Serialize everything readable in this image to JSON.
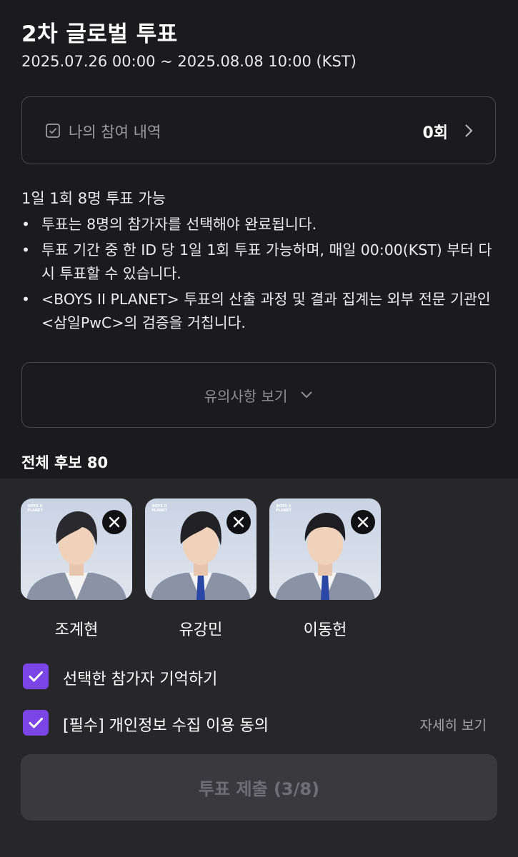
{
  "header": {
    "title": "2차 글로벌 투표",
    "period": "2025.07.26 00:00 ~ 2025.08.08 10:00 (KST)"
  },
  "history": {
    "label": "나의 참여 내역",
    "count": "0회"
  },
  "rules": {
    "headline": "1일 1회 8명 투표 가능",
    "items": [
      "투표는 8명의 참가자를 선택해야 완료됩니다.",
      "투표 기간 중 한 ID 당 1일 1회 투표 가능하며, 매일 00:00(KST) 부터 다시 투표할 수 있습니다.",
      "<BOYS II PLANET> 투표의 산출 과정 및 결과 집계는 외부 전문 기관인 <삼일PwC>의 검증을 거칩니다."
    ]
  },
  "notice": {
    "label": "유의사항 보기"
  },
  "candidates_total": "전체 후보 80",
  "selected": [
    {
      "name": "조계현",
      "logo": "BOYS II PLANET"
    },
    {
      "name": "유강민",
      "logo": "BOYS II PLANET"
    },
    {
      "name": "이동헌",
      "logo": "BOYS II PLANET"
    }
  ],
  "options": {
    "remember": {
      "label": "선택한 참가자 기억하기",
      "checked": true
    },
    "consent": {
      "label": "[필수] 개인정보 수집 이용 동의",
      "checked": true,
      "detail": "자세히 보기"
    }
  },
  "submit": {
    "label": "투표 제출 (3/8)"
  },
  "colors": {
    "background": "#1b1b1d",
    "sheet": "#27272a",
    "accent": "#7b45e6",
    "submit_disabled": "#3a3a3e"
  },
  "icons": {
    "history": "checkbox-icon",
    "history_arrow": "chevron-right-icon",
    "notice": "chevron-down-icon",
    "remove": "close-icon",
    "option": "check-icon"
  }
}
